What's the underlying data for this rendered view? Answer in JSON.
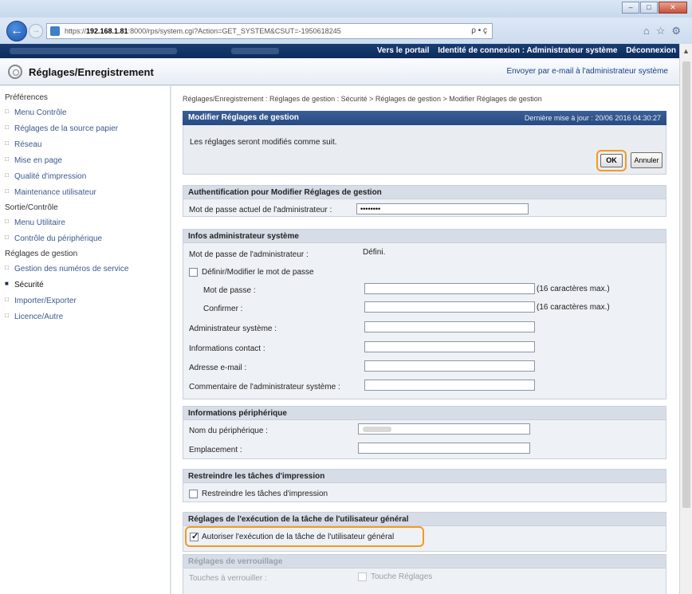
{
  "browser": {
    "url_prefix": "https://",
    "url_host": "192.168.1.81",
    "url_rest": ":8000/rps/system.cgi?Action=GET_SYSTEM&CSUT=-1950618245",
    "url_tail": "ρ • ç",
    "icons": [
      "home-icon",
      "star-icon",
      "gear-icon"
    ]
  },
  "topbar": {
    "portal_link": "Vers le portail",
    "login_label": "Identité de connexion : Administrateur système",
    "logout_link": "Déconnexion"
  },
  "header": {
    "title": "Réglages/Enregistrement",
    "email_link": "Envoyer par e-mail à l'administrateur système"
  },
  "sidebar": {
    "sections": [
      {
        "heading": "Préférences",
        "items": [
          "Menu Contrôle",
          "Réglages de la source papier",
          "Réseau",
          "Mise en page",
          "Qualité d'impression",
          "Maintenance utilisateur"
        ]
      },
      {
        "heading": "Sortie/Contrôle",
        "items": [
          "Menu Utilitaire",
          "Contrôle du périphérique"
        ]
      },
      {
        "heading": "Réglages de gestion",
        "items": [
          "Gestion des numéros de service",
          "Sécurité",
          "Importer/Exporter",
          "Licence/Autre"
        ]
      }
    ],
    "active_item": "Sécurité"
  },
  "main": {
    "breadcrumb": "Réglages/Enregistrement : Réglages de gestion : Sécurité > Réglages de gestion > Modifier Réglages de gestion",
    "modify_header": "Modifier Réglages de gestion",
    "last_update": "Dernière mise à jour : 20/06 2016 04:30:27",
    "message": "Les réglages seront modifiés comme suit.",
    "ok_label": "OK",
    "cancel_label": "Annuler",
    "auth": {
      "header": "Authentification pour Modifier Réglages de gestion",
      "current_password_label": "Mot de passe actuel de l'administrateur :",
      "current_password_value": "••••••••"
    },
    "admin": {
      "header": "Infos administrateur système",
      "password_label": "Mot de passe de l'administrateur :",
      "password_status": "Défini.",
      "set_password_label": "Définir/Modifier le mot de passe",
      "new_password_label": "Mot de passe :",
      "confirm_label": "Confirmer :",
      "max_chars_1": "(16 caractères max.)",
      "max_chars_2": "(16 caractères max.)",
      "sysadmin_label": "Administrateur système :",
      "contact_label": "Informations contact :",
      "email_label": "Adresse e-mail :",
      "comment_label": "Commentaire de l'administrateur système :"
    },
    "device": {
      "header": "Informations périphérique",
      "name_label": "Nom du périphérique :",
      "location_label": "Emplacement :"
    },
    "restrict": {
      "header": "Restreindre les tâches d'impression",
      "checkbox_label": "Restreindre les tâches d'impression"
    },
    "general_user": {
      "header": "Réglages de l'exécution de la tâche de l'utilisateur général",
      "checkbox_label": "Autoriser l'exécution de la tâche de l'utilisateur général",
      "checked": true
    },
    "lock": {
      "header": "Réglages de verrouillage",
      "keys_label": "Touches à verrouiller :",
      "key_option_1": "Touche Réglages"
    }
  }
}
